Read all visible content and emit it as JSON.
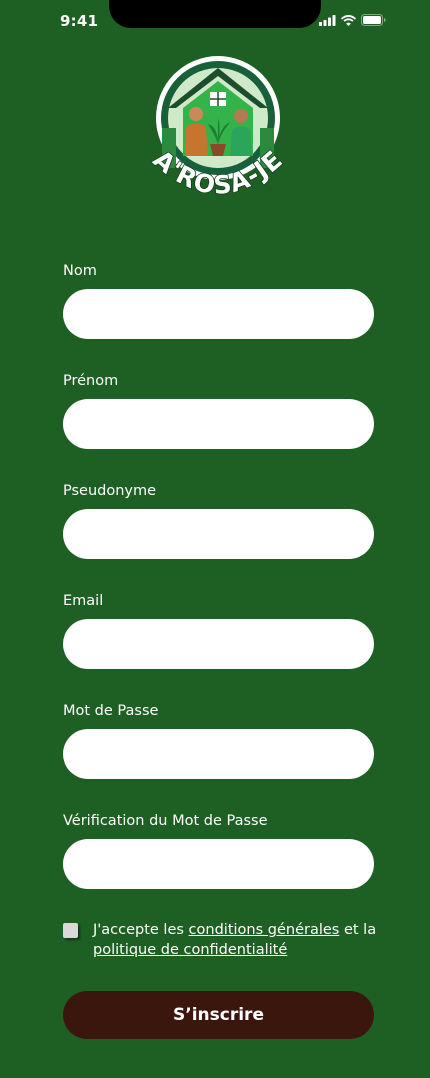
{
  "status_bar": {
    "time": "9:41",
    "icons": [
      "cellular-signal-icon",
      "wifi-icon",
      "battery-icon"
    ]
  },
  "logo": {
    "text": "A'ROSA-JE",
    "colors": {
      "ring": "#1a6a35",
      "house": "#2fb344",
      "sky": "#c9e6c4",
      "text": "#ffffff"
    }
  },
  "form": {
    "fields": [
      {
        "label": "Nom",
        "value": ""
      },
      {
        "label": "Prénom",
        "value": ""
      },
      {
        "label": "Pseudonyme",
        "value": ""
      },
      {
        "label": "Email",
        "value": ""
      },
      {
        "label": "Mot de Passe",
        "value": ""
      },
      {
        "label": "Vérification du Mot de Passe",
        "value": ""
      }
    ],
    "consent": {
      "checked": false,
      "prefix": "J'accepte les ",
      "link1": "conditions générales",
      "middle": " et la ",
      "link2": "politique de confidentialité"
    },
    "submit_label": "S’inscrire"
  },
  "colors": {
    "background": "#1e6024",
    "input_background": "#ffffff",
    "button_background": "#3b160d",
    "text": "#ffffff"
  }
}
